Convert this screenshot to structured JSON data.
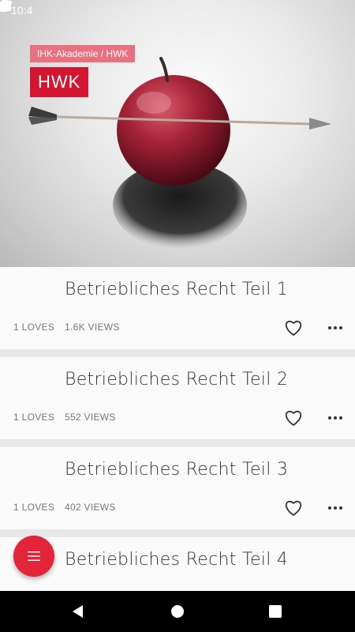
{
  "status_bar": {
    "time": "10:4"
  },
  "hero": {
    "category": "IHK-Akademie / HWK",
    "brand": "HWK"
  },
  "items": [
    {
      "title": "Betriebliches Recht Teil 1",
      "loves": "1 LOVES",
      "views": "1.6K VIEWS"
    },
    {
      "title": "Betriebliches Recht Teil 2",
      "loves": "1 LOVES",
      "views": "552 VIEWS"
    },
    {
      "title": "Betriebliches Recht Teil 3",
      "loves": "1 LOVES",
      "views": "402 VIEWS"
    },
    {
      "title": "Betriebliches Recht Teil 4"
    }
  ],
  "colors": {
    "accent": "#e3253a",
    "brand": "#d41530",
    "chip": "#e8707f"
  }
}
